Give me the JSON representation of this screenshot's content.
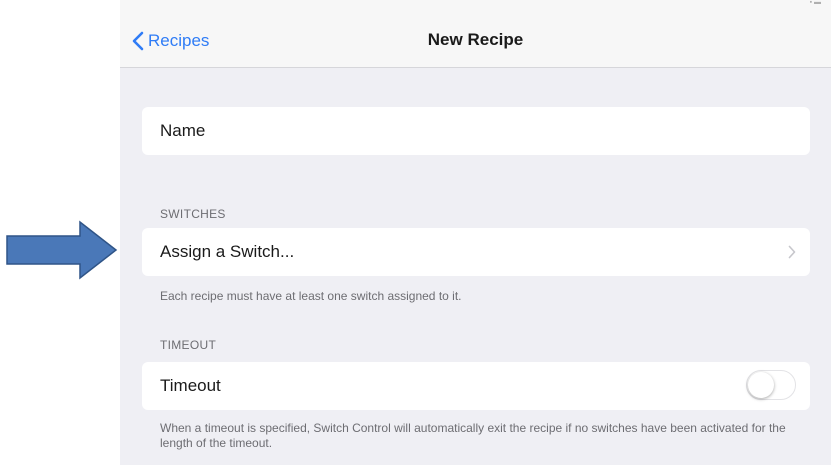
{
  "navbar": {
    "back_label": "Recipes",
    "title": "New Recipe"
  },
  "name_cell": {
    "label": "Name"
  },
  "switches": {
    "header": "SWITCHES",
    "assign_label": "Assign a Switch...",
    "footer": "Each recipe must have at least one switch assigned to it."
  },
  "timeout": {
    "header": "TIMEOUT",
    "label": "Timeout",
    "toggle_on": false,
    "footer": "When a timeout is specified, Switch Control will automatically exit the recipe if no switches have been activated for the length of the timeout."
  },
  "colors": {
    "accent": "#2f7cf6",
    "background": "#efeff4",
    "annotation_arrow": "#4a78b8"
  }
}
